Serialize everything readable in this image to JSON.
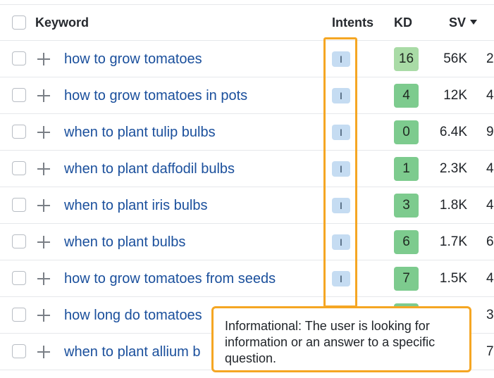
{
  "header": {
    "keyword_label": "Keyword",
    "intents_label": "Intents",
    "kd_label": "KD",
    "sv_label": "SV"
  },
  "rows": [
    {
      "keyword": "how to grow tomatoes",
      "intent": "I",
      "kd": "16",
      "kd_color": "#a9dba6",
      "sv": "56K",
      "extra": "2"
    },
    {
      "keyword": "how to grow tomatoes in pots",
      "intent": "I",
      "kd": "4",
      "kd_color": "#7dcb8e",
      "sv": "12K",
      "extra": "4"
    },
    {
      "keyword": "when to plant tulip bulbs",
      "intent": "I",
      "kd": "0",
      "kd_color": "#7dcb8e",
      "sv": "6.4K",
      "extra": "9"
    },
    {
      "keyword": "when to plant daffodil bulbs",
      "intent": "I",
      "kd": "1",
      "kd_color": "#7dcb8e",
      "sv": "2.3K",
      "extra": "4"
    },
    {
      "keyword": "when to plant iris bulbs",
      "intent": "I",
      "kd": "3",
      "kd_color": "#7dcb8e",
      "sv": "1.8K",
      "extra": "4"
    },
    {
      "keyword": "when to plant bulbs",
      "intent": "I",
      "kd": "6",
      "kd_color": "#7dcb8e",
      "sv": "1.7K",
      "extra": "6"
    },
    {
      "keyword": "how to grow tomatoes from seeds",
      "intent": "I",
      "kd": "7",
      "kd_color": "#7dcb8e",
      "sv": "1.5K",
      "extra": "4"
    },
    {
      "keyword": "how long do tomatoes",
      "intent": "",
      "kd": "",
      "kd_color": "#7dcb8e",
      "sv": "",
      "extra": "3"
    },
    {
      "keyword": "when to plant allium b",
      "intent": "",
      "kd": "",
      "kd_color": "#7dcb8e",
      "sv": "",
      "extra": "7"
    }
  ],
  "tooltip": {
    "text": "Informational: The user is looking for information or an answer to a specific question."
  },
  "colors": {
    "highlight": "#f5a623",
    "link": "#1a4f9c",
    "intent_badge": "#c5dcf2"
  }
}
